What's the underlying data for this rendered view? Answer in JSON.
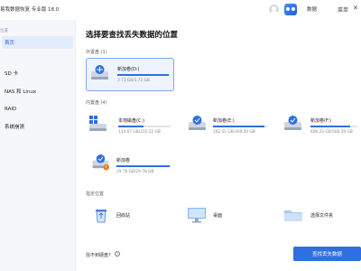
{
  "titlebar": {
    "app_title": "易我数据恢复 专业版 18.0",
    "data_label": "数据",
    "minimize_label": "菜单",
    "close_label": "✕"
  },
  "sidebar": {
    "section_top": "位置",
    "items": [
      {
        "label": "首页",
        "active": true
      },
      {
        "label": "SD 卡"
      },
      {
        "label": "NAS 和 Linux"
      },
      {
        "label": "RAID"
      },
      {
        "label": "系统崩溃"
      }
    ]
  },
  "main": {
    "title": "选择要查找丢失数据的位置",
    "external_section": "外置盘 (1)",
    "internal_section": "内置盘 (4)",
    "specific_section": "指定位置",
    "external_drives": [
      {
        "name": "新加卷(D:)",
        "size": "3.71 GB/3.72 GB",
        "fill": 0.99
      }
    ],
    "internal_drives": [
      {
        "name": "本地磁盘(C:)",
        "size": "114.07 GB/232.22 GB",
        "fill": 0.49
      },
      {
        "name": "新加卷(E:)",
        "size": "292.51 GB/309.50 GB",
        "fill": 0.95
      },
      {
        "name": "新加卷(F:)",
        "size": "486.23 GB/580.59 GB",
        "fill": 0.84
      },
      {
        "name": "新加卷",
        "size": "29.76 GB/29.78 GB",
        "fill": 0.99
      }
    ],
    "locations": [
      {
        "name": "回收站"
      },
      {
        "name": "桌面"
      },
      {
        "name": "选择文件夹"
      }
    ]
  },
  "footer": {
    "missing_link": "找不到硬盘?",
    "help": "?",
    "scan_button": "查找丢失数据"
  },
  "colors": {
    "accent": "#2f6fe0",
    "sidebar_bg": "#f6f7fa",
    "selected_bg": "#eef3fd"
  }
}
